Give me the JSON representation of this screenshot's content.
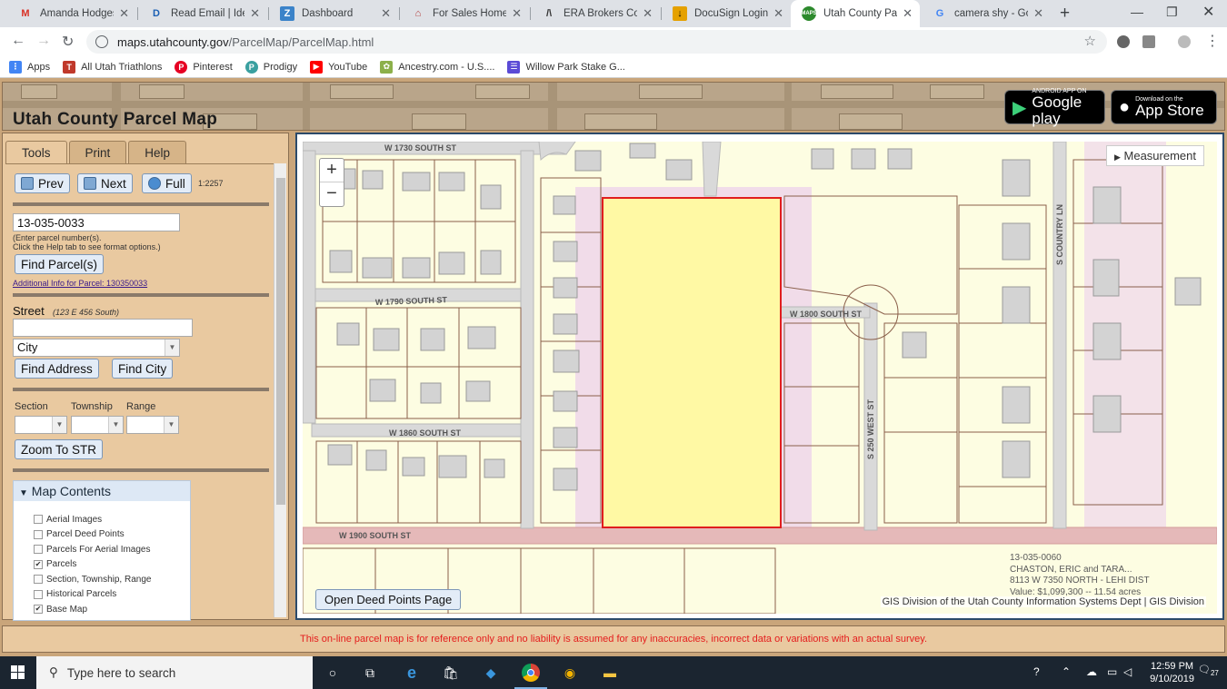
{
  "browser": {
    "tabs": [
      {
        "title": "Amanda Hodges ",
        "icon": "gmail-icon",
        "color": "#d93025",
        "glyph": "M"
      },
      {
        "title": "Read Email | Identi",
        "icon": "identity-icon",
        "color": "#1a5fb4",
        "glyph": "D"
      },
      {
        "title": "Dashboard",
        "icon": "zoho-icon",
        "color": "#3b83c9",
        "glyph": "Z"
      },
      {
        "title": "For Sales Homes S",
        "icon": "home-icon",
        "color": "#b33b3b",
        "glyph": "⌂"
      },
      {
        "title": "ERA Brokers Conso",
        "icon": "era-icon",
        "color": "#333333",
        "glyph": "/\\"
      },
      {
        "title": "DocuSign Login - E",
        "icon": "docusign-icon",
        "color": "#e5a100",
        "glyph": "↓"
      },
      {
        "title": "Utah County Parce",
        "icon": "maps-icon",
        "color": "#2d8a2d",
        "glyph": "●"
      },
      {
        "title": "camera shy - Goog",
        "icon": "google-icon",
        "color": "#4285f4",
        "glyph": "G"
      }
    ],
    "url_domain": "maps.utahcounty.gov",
    "url_path": "/ParcelMap/ParcelMap.html",
    "bookmarks": [
      {
        "label": "Apps",
        "icon": "apps-icon",
        "color": "#4285f4"
      },
      {
        "label": "All Utah Triathlons",
        "icon": "triathlon-icon",
        "color": "#c0392b"
      },
      {
        "label": "Pinterest",
        "icon": "pinterest-icon",
        "color": "#e60023"
      },
      {
        "label": "Prodigy",
        "icon": "prodigy-icon",
        "color": "#3aa0a0"
      },
      {
        "label": "YouTube",
        "icon": "youtube-icon",
        "color": "#ff0000"
      },
      {
        "label": "Ancestry.com - U.S....",
        "icon": "ancestry-icon",
        "color": "#8cb04a"
      },
      {
        "label": "Willow Park Stake G...",
        "icon": "calendar-icon",
        "color": "#5b4bd6"
      }
    ]
  },
  "app": {
    "title": "Utah County Parcel Map",
    "google_play": {
      "small": "ANDROID APP ON",
      "big": "Google play"
    },
    "app_store": {
      "small": "Download on the",
      "big": "App Store"
    },
    "tabs": [
      "Tools",
      "Print",
      "Help"
    ],
    "nav": {
      "prev": "Prev",
      "next": "Next",
      "full": "Full",
      "scale": "1:2257"
    },
    "parcel": {
      "value": "13-035-0033",
      "hint1": "(Enter parcel number(s).",
      "hint2": "Click the Help tab to see format options.)",
      "find_btn": "Find Parcel(s)",
      "info_link": "Additional Info for Parcel: 130350033"
    },
    "street": {
      "label": "Street",
      "hint": "(123 E 456 South)",
      "value": "",
      "city": "City",
      "find_address": "Find Address",
      "find_city": "Find City"
    },
    "str": {
      "section": "Section",
      "township": "Township",
      "range": "Range",
      "zoom_btn": "Zoom To STR"
    },
    "map_contents": {
      "title": "Map Contents",
      "layers": [
        {
          "label": "Aerial Images",
          "checked": false
        },
        {
          "label": "Parcel Deed Points",
          "checked": false
        },
        {
          "label": "Parcels For Aerial Images",
          "checked": false
        },
        {
          "label": "Parcels",
          "checked": true
        },
        {
          "label": "Section, Township, Range",
          "checked": false
        },
        {
          "label": "Historical Parcels",
          "checked": false
        },
        {
          "label": "Base Map",
          "checked": true
        }
      ]
    },
    "map": {
      "measurement": "Measurement",
      "open_deed": "Open Deed Points Page",
      "credit": "GIS Division of the Utah County Information Systems Dept | GIS Division",
      "streets": [
        "W 1730 SOUTH ST",
        "W 1790 SOUTH ST",
        "W 1860 SOUTH ST",
        "W 1900 SOUTH ST",
        "W 1800 SOUTH ST",
        "S 250 WEST ST",
        "S COUNTRY LN"
      ],
      "popup": [
        "13-035-0060",
        "CHASTON, ERIC and TARA...",
        "8113 W 7350 NORTH  - LEHI DIST",
        "Value: $1,099,300 -- 11.54 acres"
      ]
    },
    "disclaimer": "This on-line parcel map is for reference only and no liability is assumed for any inaccuracies, incorrect data or variations with an actual survey."
  },
  "taskbar": {
    "search_placeholder": "Type here to search",
    "time": "12:59 PM",
    "date": "9/10/2019",
    "notifications": "27"
  }
}
